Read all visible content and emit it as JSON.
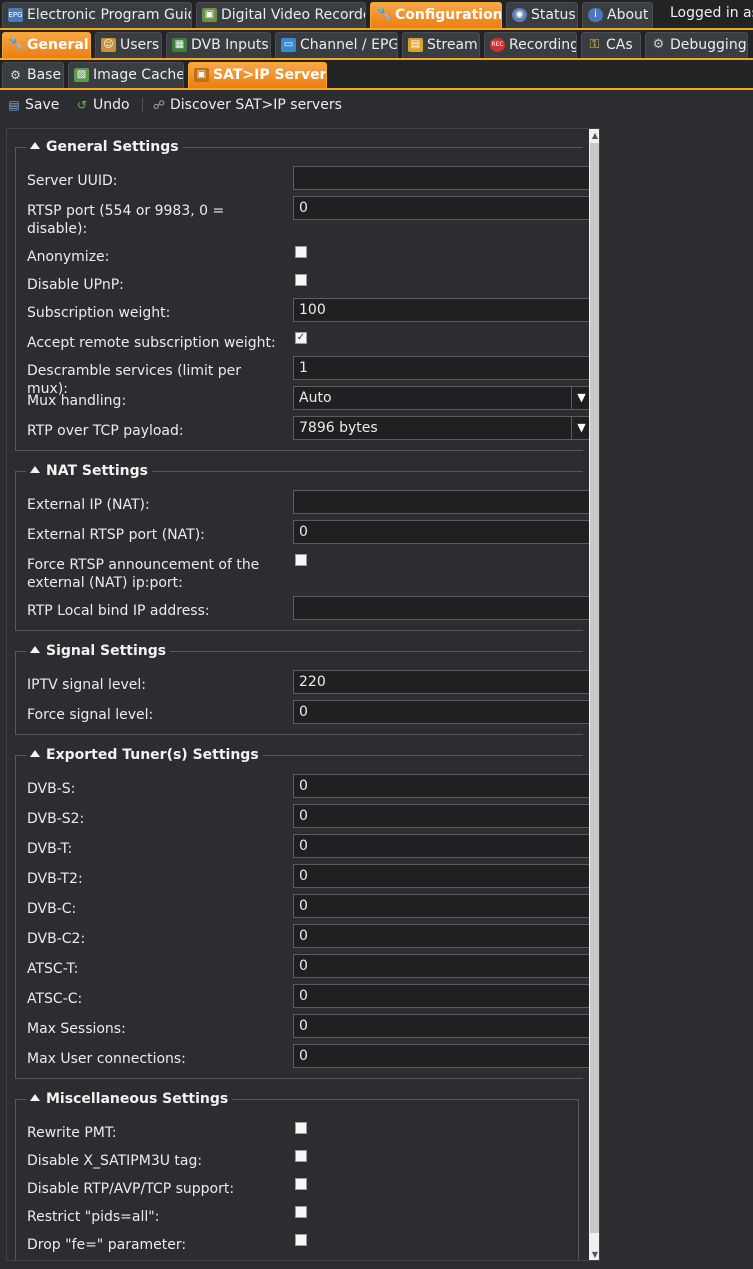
{
  "top_tabs": [
    {
      "label": "Electronic Program Guide",
      "icon": "epg-icon"
    },
    {
      "label": "Digital Video Recorder",
      "icon": "dvr-icon"
    },
    {
      "label": "Configuration",
      "icon": "wrench-icon"
    },
    {
      "label": "Status",
      "icon": "eye-icon"
    },
    {
      "label": "About",
      "icon": "info-icon"
    }
  ],
  "logged_in": "Logged in as",
  "config_tabs": [
    {
      "label": "General",
      "icon": "wrench-icon"
    },
    {
      "label": "Users",
      "icon": "users-icon"
    },
    {
      "label": "DVB Inputs",
      "icon": "tuner-icon"
    },
    {
      "label": "Channel / EPG",
      "icon": "tv-icon"
    },
    {
      "label": "Stream",
      "icon": "stream-icon"
    },
    {
      "label": "Recording",
      "icon": "rec-icon"
    },
    {
      "label": "CAs",
      "icon": "key-icon"
    },
    {
      "label": "Debugging",
      "icon": "gears-icon"
    }
  ],
  "sub_tabs": [
    {
      "label": "Base",
      "icon": "base-icon"
    },
    {
      "label": "Image Cache",
      "icon": "image-icon"
    },
    {
      "label": "SAT>IP Server",
      "icon": "satip-icon"
    }
  ],
  "toolbar": {
    "save": "Save",
    "undo": "Undo",
    "discover": "Discover SAT>IP servers"
  },
  "sections": {
    "general": {
      "title": "General Settings",
      "server_uuid": {
        "label": "Server UUID:",
        "value": ""
      },
      "rtsp_port": {
        "label": "RTSP port (554 or 9983, 0 = disable):",
        "value": "0"
      },
      "anonymize": {
        "label": "Anonymize:",
        "checked": false
      },
      "disable_upnp": {
        "label": "Disable UPnP:",
        "checked": false
      },
      "subscription_weight": {
        "label": "Subscription weight:",
        "value": "100"
      },
      "accept_remote_weight": {
        "label": "Accept remote subscription weight:",
        "checked": true
      },
      "descramble_services": {
        "label": "Descramble services (limit per mux):",
        "value": "1"
      },
      "mux_handling": {
        "label": "Mux handling:",
        "value": "Auto"
      },
      "rtp_over_tcp": {
        "label": "RTP over TCP payload:",
        "value": "7896 bytes"
      }
    },
    "nat": {
      "title": "NAT Settings",
      "external_ip": {
        "label": "External IP (NAT):",
        "value": ""
      },
      "external_rtsp_port": {
        "label": "External RTSP port (NAT):",
        "value": "0"
      },
      "force_rtsp": {
        "label": "Force RTSP announcement of the external (NAT) ip:port:",
        "checked": false
      },
      "rtp_local_bind": {
        "label": "RTP Local bind IP address:",
        "value": ""
      }
    },
    "signal": {
      "title": "Signal Settings",
      "iptv_signal": {
        "label": "IPTV signal level:",
        "value": "220"
      },
      "force_signal": {
        "label": "Force signal level:",
        "value": "0"
      }
    },
    "tuners": {
      "title": "Exported Tuner(s) Settings",
      "rows": [
        {
          "label": "DVB-S:",
          "value": "0"
        },
        {
          "label": "DVB-S2:",
          "value": "0"
        },
        {
          "label": "DVB-T:",
          "value": "0"
        },
        {
          "label": "DVB-T2:",
          "value": "0"
        },
        {
          "label": "DVB-C:",
          "value": "0"
        },
        {
          "label": "DVB-C2:",
          "value": "0"
        },
        {
          "label": "ATSC-T:",
          "value": "0"
        },
        {
          "label": "ATSC-C:",
          "value": "0"
        },
        {
          "label": "Max Sessions:",
          "value": "0"
        },
        {
          "label": "Max User connections:",
          "value": "0"
        }
      ]
    },
    "misc": {
      "title": "Miscellaneous Settings",
      "rows": [
        {
          "label": "Rewrite PMT:",
          "checked": false
        },
        {
          "label": "Disable X_SATIPM3U tag:",
          "checked": false
        },
        {
          "label": "Disable RTP/AVP/TCP support:",
          "checked": false
        },
        {
          "label": "Restrict \"pids=all\":",
          "checked": false
        },
        {
          "label": "Drop \"fe=\" parameter:",
          "checked": false
        }
      ]
    }
  },
  "colors": {
    "accent": "#f08b1a",
    "background": "#2b2d30",
    "tab": "#3a3d41"
  }
}
